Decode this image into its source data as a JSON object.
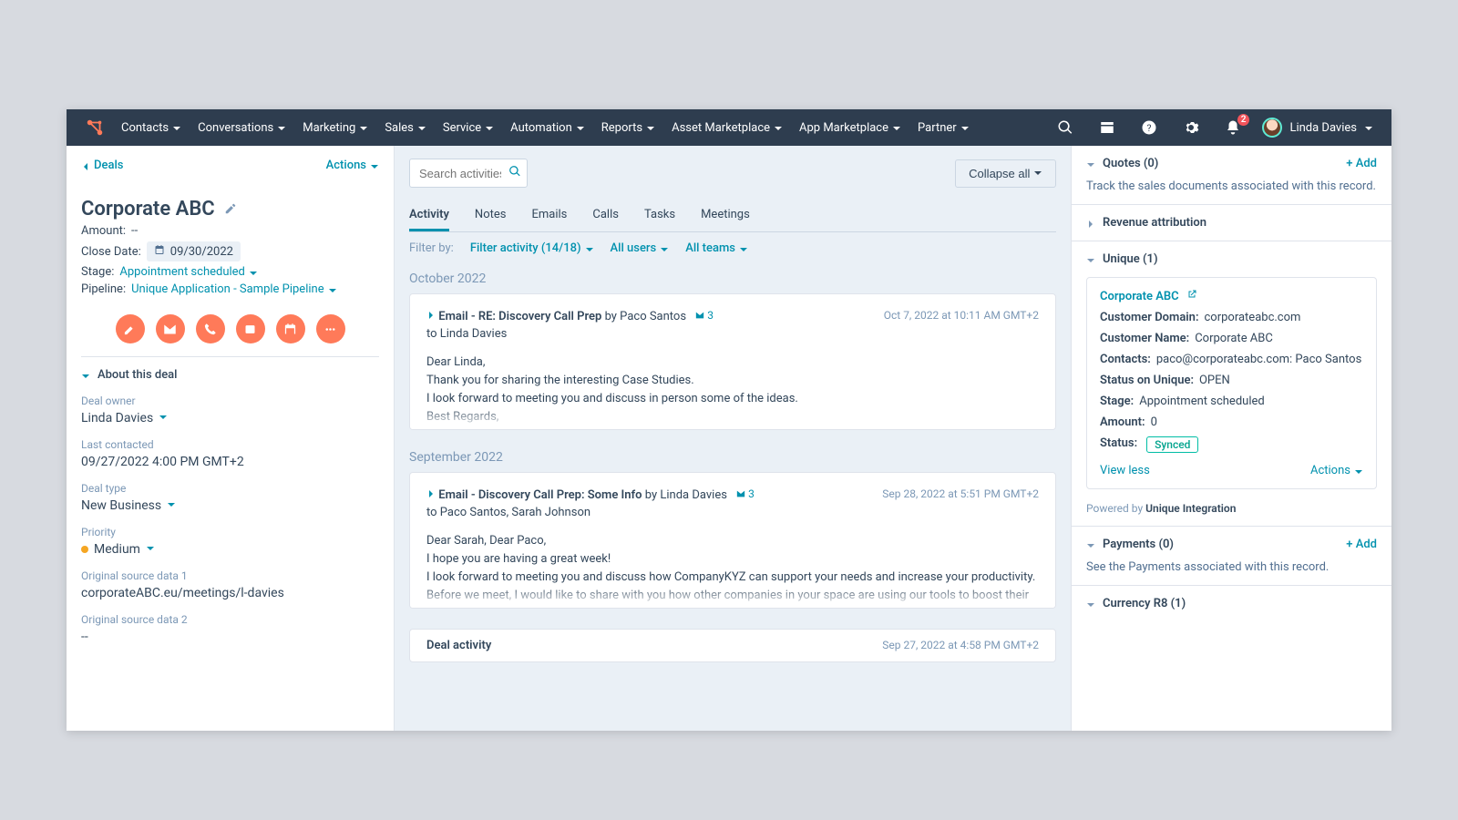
{
  "nav": {
    "items": [
      "Contacts",
      "Conversations",
      "Marketing",
      "Sales",
      "Service",
      "Automation",
      "Reports",
      "Asset Marketplace",
      "App Marketplace",
      "Partner"
    ],
    "notification_count": "2",
    "user_name": "Linda Davies"
  },
  "left": {
    "back_label": "Deals",
    "actions_label": "Actions",
    "title": "Corporate ABC",
    "amount_label": "Amount:",
    "amount_value": "--",
    "close_date_label": "Close Date:",
    "close_date_value": "09/30/2022",
    "stage_label": "Stage:",
    "stage_value": "Appointment scheduled",
    "pipeline_label": "Pipeline:",
    "pipeline_value": "Unique Application - Sample Pipeline",
    "about_header": "About this deal",
    "props": {
      "owner_label": "Deal owner",
      "owner_value": "Linda Davies",
      "last_contacted_label": "Last contacted",
      "last_contacted_value": "09/27/2022 4:00 PM GMT+2",
      "deal_type_label": "Deal type",
      "deal_type_value": "New Business",
      "priority_label": "Priority",
      "priority_value": "Medium",
      "osd1_label": "Original source data 1",
      "osd1_value": "corporateABC.eu/meetings/l-davies",
      "osd2_label": "Original source data 2",
      "osd2_value": "--"
    }
  },
  "mid": {
    "search_placeholder": "Search activities",
    "collapse_label": "Collapse all",
    "tabs": [
      "Activity",
      "Notes",
      "Emails",
      "Calls",
      "Tasks",
      "Meetings"
    ],
    "filter_by_label": "Filter by:",
    "filter_activity": "Filter activity (14/18)",
    "filter_users": "All users",
    "filter_teams": "All teams",
    "groups": [
      {
        "month": "October 2022",
        "cards": [
          {
            "title": "Email - RE: Discovery Call Prep",
            "by": "by Paco Santos",
            "thread": "3",
            "time": "Oct 7, 2022 at 10:11 AM GMT+2",
            "to": "to Linda Davies",
            "body1": "Dear Linda,",
            "body2": "Thank you for sharing the interesting Case Studies.",
            "body3": "I look forward to meeting you and discuss in person some of the ideas.",
            "body4": "Best Regards,"
          }
        ]
      },
      {
        "month": "September 2022",
        "cards": [
          {
            "title": "Email - Discovery Call Prep: Some Info",
            "by": "by Linda Davies",
            "thread": "3",
            "time": "Sep 28, 2022 at 5:51 PM GMT+2",
            "to": "to Paco Santos, Sarah Johnson",
            "body1": "Dear Sarah, Dear Paco,",
            "body2": "I hope you are having a great week!",
            "body3": "I look forward to meeting you and discuss how CompanyKYZ can support your needs and increase your productivity.",
            "body4": "Before we meet, I would like to share with you how other companies in your space are using our tools to boost their business."
          },
          {
            "title": "Deal activity",
            "by": "",
            "thread": "",
            "time": "Sep 27, 2022 at 4:58 PM GMT+2",
            "to": "",
            "body1": "",
            "body2": "",
            "body3": "",
            "body4": ""
          }
        ]
      }
    ]
  },
  "right": {
    "quotes_title": "Quotes (0)",
    "quotes_add": "+ Add",
    "quotes_desc": "Track the sales documents associated with this record.",
    "rev_title": "Revenue attribution",
    "unique_title": "Unique (1)",
    "unique_card": {
      "name": "Corporate ABC",
      "domain_k": "Customer Domain:",
      "domain_v": "corporateabc.com",
      "cname_k": "Customer Name:",
      "cname_v": "Corporate ABC",
      "contacts_k": "Contacts:",
      "contacts_v": "paco@corporateabc.com: Paco Santos",
      "statusu_k": "Status on Unique:",
      "statusu_v": "OPEN",
      "stage_k": "Stage:",
      "stage_v": "Appointment scheduled",
      "amount_k": "Amount:",
      "amount_v": "0",
      "status_k": "Status:",
      "status_v": "Synced",
      "view_less": "View less",
      "actions": "Actions"
    },
    "powered": "Powered by ",
    "powered_b": "Unique Integration",
    "payments_title": "Payments (0)",
    "payments_add": "+ Add",
    "payments_desc": "See the Payments associated with this record.",
    "currency_title": "Currency R8 (1)"
  }
}
